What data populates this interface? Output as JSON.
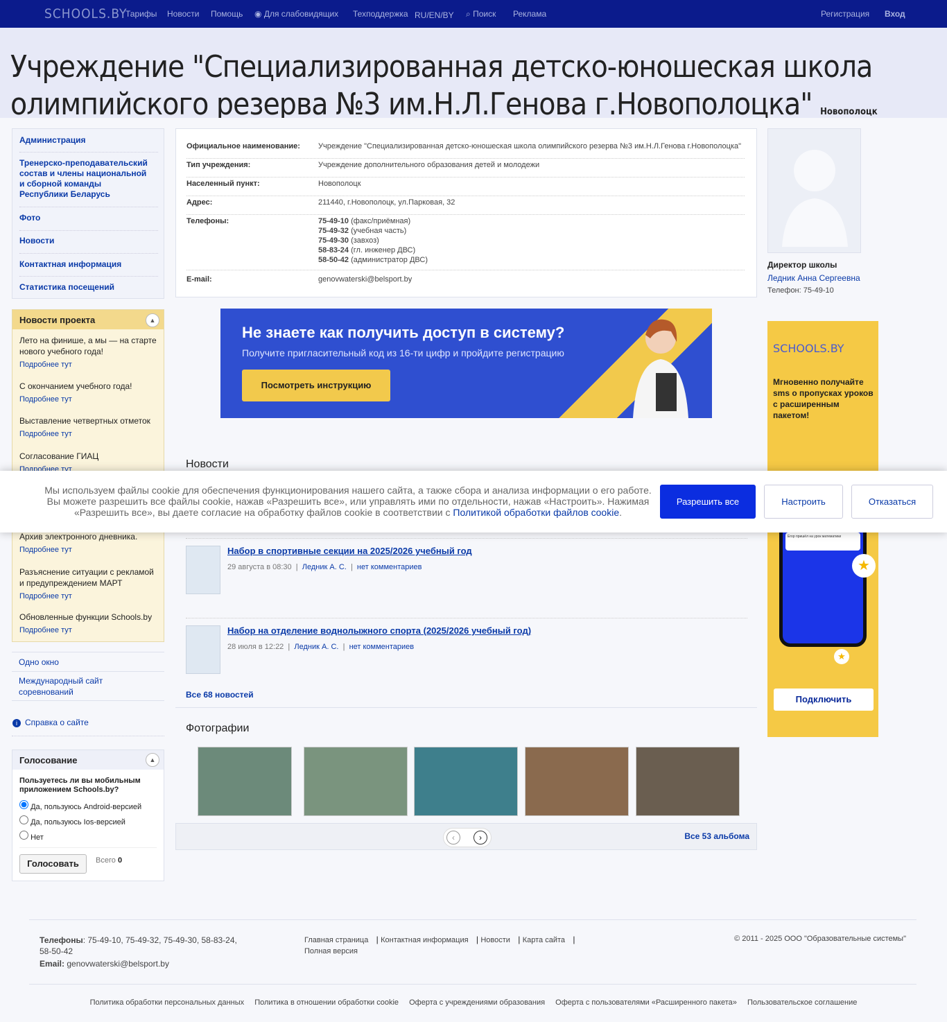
{
  "topbar": {
    "logo": "SCHOOLS.BY",
    "tariffs": "Тарифы",
    "news": "Новости",
    "help": "Помощь",
    "visually": "Для слабовидящих",
    "support": "Техподдержка",
    "lang": "RU/EN/BY",
    "search": "Поиск",
    "ads": "Реклама",
    "register": "Регистрация",
    "login": "Вход"
  },
  "hero": {
    "title": "Учреждение \"Специализированная детско-юношеская школа олимпийского резерва №3 им.Н.Л.Генова г.Новополоцка\"",
    "city": "Новополоцк"
  },
  "menu": [
    "Администрация",
    "Тренерско-преподавательский состав и члены национальной и сборной команды Республики Беларусь",
    "Фото",
    "Новости",
    "Контактная информация",
    "Статистика посещений"
  ],
  "project_news": {
    "title": "Новости проекта",
    "more": "Подробнее тут",
    "items": [
      "Лето на финише, а мы — на старте нового учебного года!",
      "С окончанием учебного года!",
      "Выставление четвертных отметок",
      "Согласование ГИАЦ",
      "Архив электронного дневника.",
      "Разъяснение ситуации с рекламой и предупреждением МАРТ",
      "Обновленные функции Schools.by"
    ]
  },
  "side_links": {
    "one_window": "Одно окно",
    "intl": "Международный сайт соревнований",
    "help": "Справка о сайте"
  },
  "vote": {
    "title": "Голосование",
    "question": "Пользуетесь ли вы мобильным приложением Schools.by?",
    "options": [
      "Да, пользуюсь Android-версией",
      "Да, пользуюсь Ios-версией",
      "Нет"
    ],
    "button": "Голосовать",
    "total_label": "Всего",
    "total": "0"
  },
  "info": {
    "official_k": "Официальное наименование:",
    "official_v": "Учреждение \"Специализированная детско-юношеская школа олимпийского резерва №3 им.Н.Л.Генова г.Новополоцка\"",
    "type_k": "Тип учреждения:",
    "type_v": "Учреждение дополнительного образования детей и молодежи",
    "city_k": "Населенный пункт:",
    "city_v": "Новополоцк",
    "addr_k": "Адрес:",
    "addr_v": "211440, г.Новополоцк, ул.Парковая, 32",
    "phones_k": "Телефоны:",
    "phones": [
      {
        "num": "75-49-10",
        "note": " (факс/приёмная)"
      },
      {
        "num": "75-49-32",
        "note": " (учебная часть)"
      },
      {
        "num": "75-49-30",
        "note": " (завхоз)"
      },
      {
        "num": "58-83-24",
        "note": " (гл. инженер ДВС)"
      },
      {
        "num": "58-50-42",
        "note": " (администратор ДВС)"
      }
    ],
    "email_k": "E-mail:",
    "email_v": "genovwaterski@belsport.by"
  },
  "banner": {
    "title": "Не знаете как получить доступ в систему?",
    "text": "Получите пригласительный код из 16-ти цифр и пройдите регистрацию",
    "button": "Посмотреть инструкцию"
  },
  "director": {
    "role": "Директор школы",
    "name": "Ледник Анна Сергеевна",
    "phone": "Телефон: 75-49-10"
  },
  "ad": {
    "logo": "SCHOOLS.BY",
    "text": "Мгновенно получайте sms о пропусках уроков с расширенным пакетом!",
    "button": "Подключить",
    "phone_text": "Егор пришёл на урок математики"
  },
  "cookie": {
    "text": "Мы используем файлы cookie для обеспечения функционирования нашего сайта, а также сбора и анализа информации о его работе. Вы можете разрешить все файлы cookie, нажав «Разрешить все», или управлять ими по отдельности, нажав «Настроить». Нажимая «Разрешить все», вы даете согласие на обработку файлов cookie в соответствии с ",
    "link": "Политикой обработки файлов cookie",
    "allow": "Разрешить все",
    "configure": "Настроить",
    "deny": "Отказаться"
  },
  "news": {
    "title": "Новости",
    "items": [
      {
        "title": "Набор в спортивные секции на 2025/2026 учебный год",
        "date": "29 августа в 08:30",
        "author": "Ледник А. С.",
        "comments": "нет комментариев"
      },
      {
        "title": "Набор на отделение воднолыжного спорта (2025/2026 учебный год)",
        "date": "28 июля в 12:22",
        "author": "Ледник А. С.",
        "comments": "нет комментариев"
      }
    ],
    "all": "Все 68 новостей"
  },
  "photos": {
    "title": "Фотографии",
    "all": "Все 53 альбома"
  },
  "footer": {
    "phones_label": "Телефоны",
    "phones": ": 75-49-10, 75-49-32, 75-49-30, 58-83-24, 58-50-42",
    "email_label": "Email:",
    "email": "genovwaterski@belsport.by",
    "links": [
      "Главная страница",
      "Контактная информация",
      "Новости",
      "Карта сайта",
      "Полная версия"
    ],
    "copyright": "© 2011 - 2025 ООО \"Образовательные системы\"",
    "legal": [
      "Политика обработки персональных данных",
      "Политика в отношении обработки cookie",
      "Оферта с учреждениями образования",
      "Оферта с пользователями «Расширенного пакета»",
      "Пользовательское соглашение"
    ]
  }
}
